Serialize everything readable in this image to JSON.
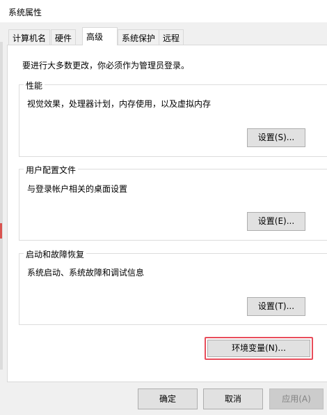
{
  "window": {
    "title": "系统属性"
  },
  "tabs": [
    {
      "label": "计算机名"
    },
    {
      "label": "硬件"
    },
    {
      "label": "高级"
    },
    {
      "label": "系统保护"
    },
    {
      "label": "远程"
    }
  ],
  "active_tab": "高级",
  "intro_text": "要进行大多数更改，你必须作为管理员登录。",
  "groups": {
    "performance": {
      "title": "性能",
      "description": "视觉效果，处理器计划，内存使用，以及虚拟内存",
      "button": "设置(S)..."
    },
    "profiles": {
      "title": "用户配置文件",
      "description": "与登录帐户相关的桌面设置",
      "button": "设置(E)..."
    },
    "startup": {
      "title": "启动和故障恢复",
      "description": "系统启动、系统故障和调试信息",
      "button": "设置(T)..."
    }
  },
  "env_button": "环境变量(N)...",
  "footer": {
    "ok": "确定",
    "cancel": "取消",
    "apply": "应用(A)"
  }
}
